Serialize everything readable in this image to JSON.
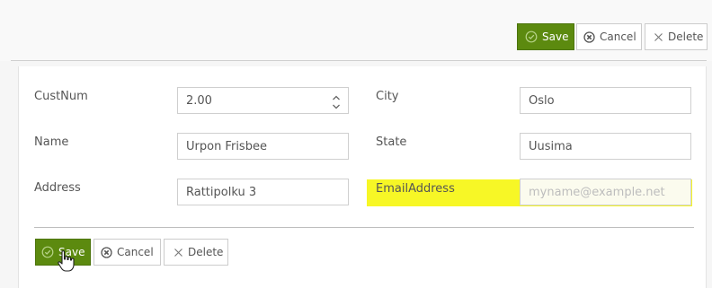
{
  "toolbar_top": {
    "save_label": "Save",
    "cancel_label": "Cancel",
    "delete_label": "Delete"
  },
  "form": {
    "custnum": {
      "label": "CustNum",
      "value": "2.00"
    },
    "name": {
      "label": "Name",
      "value": "Urpon Frisbee"
    },
    "address": {
      "label": "Address",
      "value": "Rattipolku 3"
    },
    "city": {
      "label": "City",
      "value": "Oslo"
    },
    "state": {
      "label": "State",
      "value": "Uusima"
    },
    "email": {
      "label": "EmailAddress",
      "placeholder": "myname@example.net"
    }
  },
  "toolbar_bottom": {
    "save_label": "Save",
    "cancel_label": "Cancel",
    "delete_label": "Delete"
  },
  "colors": {
    "save_bg": "#5c8a0f",
    "highlight": "#f6f600"
  },
  "icons": [
    "check-circle-icon",
    "cancel-circle-icon",
    "close-icon",
    "spinner-up-icon",
    "spinner-down-icon",
    "hand-cursor-icon"
  ]
}
